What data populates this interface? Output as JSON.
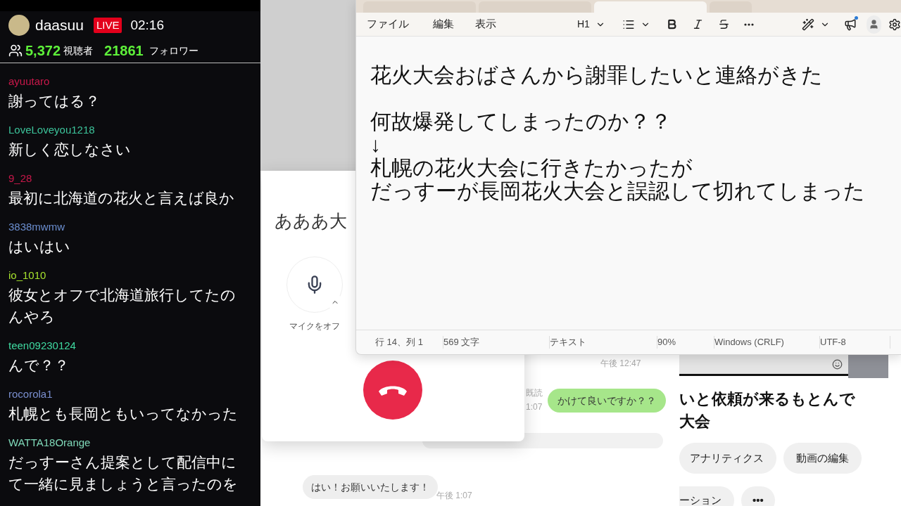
{
  "stream": {
    "channel": "daasuu",
    "live_badge": "LIVE",
    "elapsed": "02:16",
    "viewers": "5,372",
    "viewers_label": "視聴者",
    "followers": "21861",
    "followers_label": "フォロワー"
  },
  "chat": [
    {
      "user": "ayuutaro",
      "color": "#c8184a",
      "lines": [
        "謝ってはる？"
      ]
    },
    {
      "user": "LoveLoveyou1218",
      "color": "#3cc39a",
      "lines": [
        "新しく恋しなさい"
      ]
    },
    {
      "user": "9_28",
      "color": "#c8184a",
      "lines": [
        "最初に北海道の花火と言えば良か"
      ]
    },
    {
      "user": "3838mwmw",
      "color": "#6c8fd0",
      "lines": [
        "はいはい"
      ]
    },
    {
      "user": "io_1010",
      "color": "#a6e22e",
      "lines": [
        "彼女とオフで北海道旅行してたの",
        "んやろ"
      ]
    },
    {
      "user": "teen09230124",
      "color": "#3fd9a0",
      "lines": [
        "んで？？"
      ]
    },
    {
      "user": "rocorola1",
      "color": "#7a8fcf",
      "lines": [
        "札幌とも長岡ともいってなかった"
      ]
    },
    {
      "user": "WATTA18Orange",
      "color": "#7fd8b8",
      "lines": [
        "だっすーさん提案として配信中に",
        "て一緒に見ましょうと言ったのを"
      ]
    }
  ],
  "call_window": {
    "caller_text": "あああ大",
    "mic_label": "マイクをオフ"
  },
  "line_chat": {
    "time_1": "午後 12:47",
    "read_label": "既読",
    "time_2": "1:07",
    "sent_bubble": "かけて良いですか？？",
    "received_bubble": "はい！お願いいたします！",
    "time_3": "午後 1:07"
  },
  "notepad": {
    "tabs": [
      {
        "selected": false
      },
      {
        "selected": false
      },
      {
        "selected": true
      },
      {
        "selected": false
      }
    ],
    "menu": [
      "ファイル",
      "編集",
      "表示"
    ],
    "heading": "H1",
    "paragraphs": [
      [
        "花火大会おばさんから謝罪したいと連絡がきた"
      ],
      [
        "何故爆発してしまったのか？？",
        "↓",
        "札幌の花火大会に行きたかったが",
        "だっすーが長岡花火大会と誤認して切れてしまった"
      ]
    ],
    "status": [
      "行 14、列 1",
      "569 文字",
      "テキスト",
      "90%",
      "Windows (CRLF)",
      "UTF-8"
    ]
  },
  "video_page": {
    "title_lines": [
      "いと依頼が来るもとんで",
      "大会"
    ],
    "pills": [
      "アナリティクス",
      "動画の編集"
    ],
    "partial_pill": "ーション",
    "more": "•••"
  }
}
